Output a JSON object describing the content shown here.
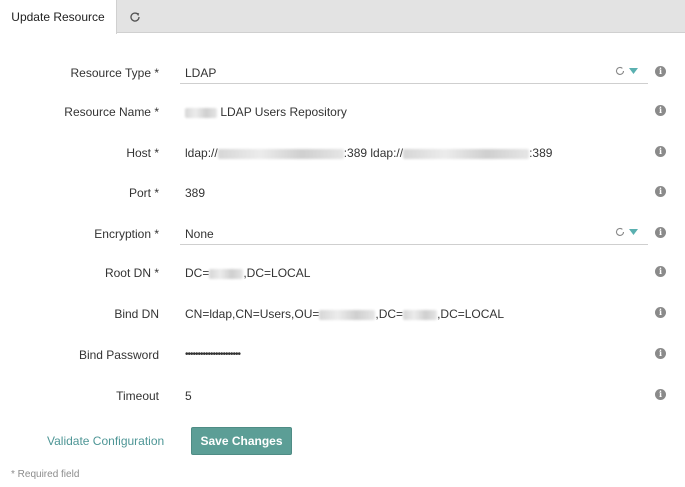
{
  "tabs": {
    "active_label": "Update Resource",
    "refresh_icon": "refresh-icon"
  },
  "form": {
    "resource_type": {
      "label": "Resource Type *",
      "value": "LDAP"
    },
    "resource_name": {
      "label": "Resource Name *",
      "value": "LDAP Users Repository"
    },
    "host": {
      "label": "Host *",
      "value_prefix": "ldap://",
      "port_suffix_1": ":389 ldap://",
      "port_suffix_2": ":389"
    },
    "port": {
      "label": "Port *",
      "value": "389"
    },
    "encryption": {
      "label": "Encryption *",
      "value": "None"
    },
    "root_dn": {
      "label": "Root DN *",
      "value_prefix": "DC=",
      "value_suffix": ",DC=LOCAL"
    },
    "bind_dn": {
      "label": "Bind DN",
      "value_prefix": "CN=ldap,CN=Users,OU=",
      "value_mid": ",DC=",
      "value_suffix": ",DC=LOCAL"
    },
    "bind_password": {
      "label": "Bind Password",
      "value": "••••••••••••••••••••••"
    },
    "timeout": {
      "label": "Timeout",
      "value": "5"
    }
  },
  "actions": {
    "validate_label": "Validate Configuration",
    "save_label": "Save Changes"
  },
  "footer": {
    "required_note": "* Required field"
  },
  "colors": {
    "accent": "#5c9e96",
    "link": "#4e9696",
    "dropdown_caret": "#5ab0b0",
    "tabbar": "#e3e3e3"
  },
  "icons": [
    "refresh-icon",
    "info-icon",
    "spinner-icon",
    "caret-down-icon"
  ]
}
